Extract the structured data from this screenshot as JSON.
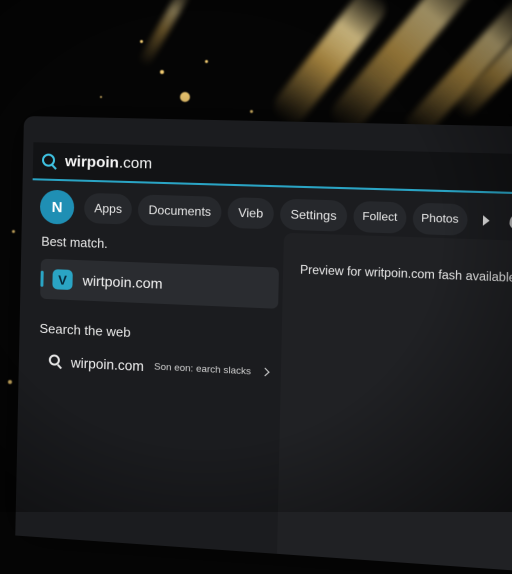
{
  "search": {
    "query_bold": "wirpoin",
    "query_rest": ".com"
  },
  "filters": {
    "avatar_initial": "N",
    "items": [
      "Apps",
      "Documents",
      "Vieb",
      "Settings",
      "Follect",
      "Photos"
    ]
  },
  "results": {
    "best_match_title": "Best match.",
    "best_match_icon_letter": "V",
    "best_match_label": "wirtpoin.com",
    "search_web_title": "Search the web",
    "web_result_label": "wirpoin.com",
    "web_result_hint": "Son eon: earch slacks"
  },
  "preview": {
    "text": "Preview for writpoin.com fash available right now"
  },
  "colors": {
    "accent": "#2aa4c4",
    "panel": "#1b1c1f"
  }
}
